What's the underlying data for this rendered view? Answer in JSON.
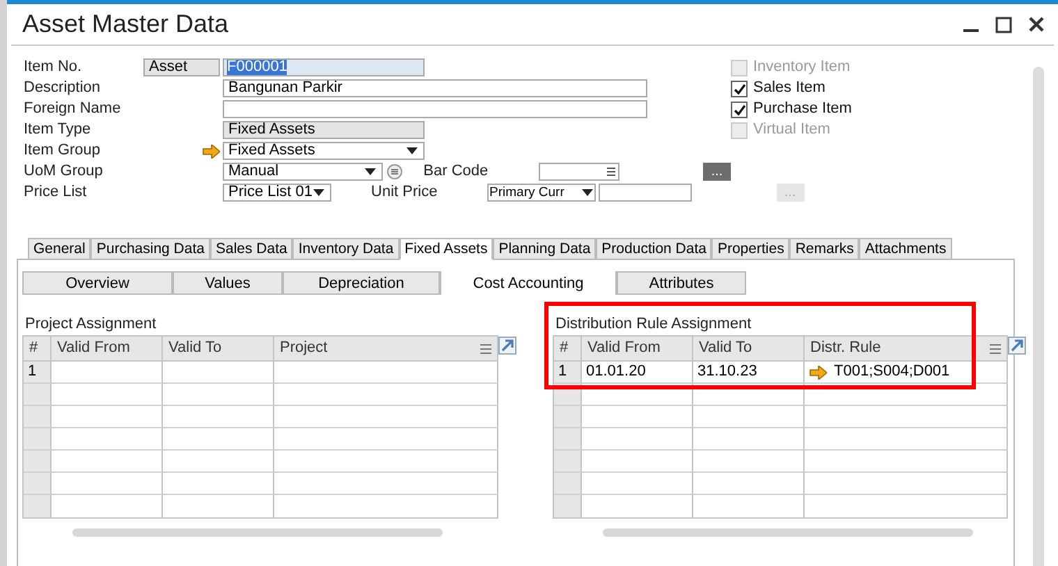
{
  "window": {
    "title": "Asset Master Data"
  },
  "form_rows": [
    {
      "label": "Item No.",
      "kind": "code",
      "prefix": "Asset",
      "value": "F000001"
    },
    {
      "label": "Description",
      "kind": "text",
      "value": "Bangunan Parkir"
    },
    {
      "label": "Foreign Name",
      "kind": "text"
    },
    {
      "label": "Item Type",
      "kind": "readonly",
      "value": "Fixed Assets"
    },
    {
      "label": "Item Group",
      "kind": "dropdown",
      "value": "Fixed Assets",
      "link_arrow": true
    },
    {
      "label": "UoM Group",
      "kind": "dropdown",
      "value": "Manual",
      "extra": {
        "kind": "barcode",
        "label": "Bar Code",
        "button": "..."
      }
    },
    {
      "label": "Price List",
      "kind": "dropdown",
      "value": "Price List 01",
      "extra": {
        "kind": "price",
        "label": "Unit Price",
        "currency": "Primary Curr",
        "button": "..."
      }
    }
  ],
  "item_flags": [
    {
      "label": "Inventory Item",
      "checked": false,
      "disabled": true
    },
    {
      "label": "Sales Item",
      "checked": true,
      "disabled": false
    },
    {
      "label": "Purchase Item",
      "checked": true,
      "disabled": false
    },
    {
      "label": "Virtual Item",
      "checked": false,
      "disabled": true
    }
  ],
  "tabs": [
    {
      "label": "General",
      "selected": false
    },
    {
      "label": "Purchasing Data",
      "selected": false
    },
    {
      "label": "Sales Data",
      "selected": false
    },
    {
      "label": "Inventory Data",
      "selected": false
    },
    {
      "label": "Fixed Assets",
      "selected": true
    },
    {
      "label": "Planning Data",
      "selected": false
    },
    {
      "label": "Production Data",
      "selected": false
    },
    {
      "label": "Properties",
      "selected": false
    },
    {
      "label": "Remarks",
      "selected": false
    },
    {
      "label": "Attachments",
      "selected": false
    }
  ],
  "sub_tabs": [
    {
      "label": "Overview",
      "selected": false
    },
    {
      "label": "Values",
      "selected": false
    },
    {
      "label": "Depreciation",
      "selected": false
    },
    {
      "label": "Cost Accounting",
      "selected": true
    },
    {
      "label": "Attributes",
      "selected": false
    }
  ],
  "tables": [
    {
      "title": "Project Assignment",
      "columns": [
        "#",
        "Valid From",
        "Valid To",
        "Project"
      ],
      "rows": [
        {
          "cells": [
            "1"
          ]
        }
      ]
    },
    {
      "title": "Distribution Rule Assignment",
      "highlighted": true,
      "columns": [
        "#",
        "Valid From",
        "Valid To",
        "Distr. Rule"
      ],
      "rows": [
        {
          "cells": [
            "1",
            "01.01.20",
            "31.10.23",
            "T001;S004;D001"
          ],
          "link_arrow": true
        }
      ]
    }
  ]
}
